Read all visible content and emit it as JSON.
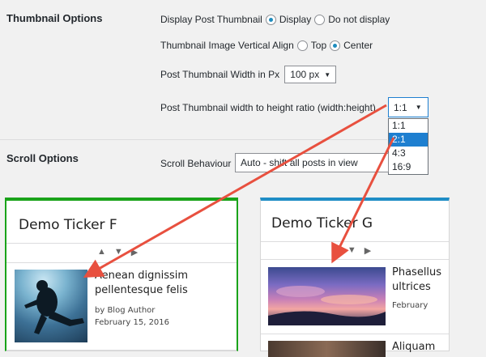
{
  "thumbnail_options": {
    "section_title": "Thumbnail Options",
    "display_label": "Display Post Thumbnail",
    "display_option": "Display",
    "no_display_option": "Do not display",
    "valign_label": "Thumbnail Image Vertical Align",
    "valign_top": "Top",
    "valign_center": "Center",
    "width_label": "Post Thumbnail Width in Px",
    "width_value": "100 px",
    "ratio_label": "Post Thumbnail width to height ratio (width:height)",
    "ratio_value": "1:1",
    "ratio_options": [
      "1:1",
      "2:1",
      "4:3",
      "16:9"
    ]
  },
  "scroll_options": {
    "section_title": "Scroll Options",
    "behaviour_label": "Scroll Behaviour",
    "behaviour_value": "Auto - shift all posts in view"
  },
  "ticker_f": {
    "title": "Demo Ticker F",
    "accent": "#1aa31a",
    "post_title_1": "Aenean dignissim",
    "post_title_2": "pellentesque felis",
    "author": "by Blog Author",
    "date": "February 15, 2016"
  },
  "ticker_g": {
    "title": "Demo Ticker G",
    "accent": "#1f8dc6",
    "post1_title_1": "Phasellus",
    "post1_title_2": "ultrices",
    "post1_date": "February",
    "post2_title": "Aliquam"
  },
  "annotation_color": "#e8503f"
}
